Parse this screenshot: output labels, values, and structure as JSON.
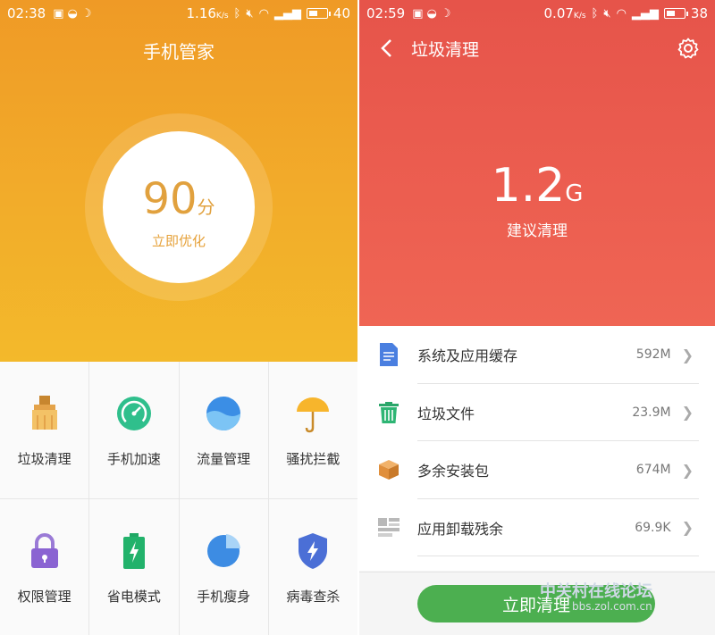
{
  "left": {
    "status": {
      "time": "02:38",
      "speed": "1.16",
      "speed_unit": "K/s",
      "battery": "40"
    },
    "title": "手机管家",
    "score": {
      "value": "90",
      "unit": "分",
      "action": "立即优化"
    },
    "tiles": [
      {
        "label": "垃圾清理",
        "icon": "broom-icon"
      },
      {
        "label": "手机加速",
        "icon": "speedometer-icon"
      },
      {
        "label": "流量管理",
        "icon": "water-globe-icon"
      },
      {
        "label": "骚扰拦截",
        "icon": "umbrella-icon"
      },
      {
        "label": "权限管理",
        "icon": "lock-icon"
      },
      {
        "label": "省电模式",
        "icon": "battery-bolt-icon"
      },
      {
        "label": "手机瘦身",
        "icon": "pie-chart-icon"
      },
      {
        "label": "病毒查杀",
        "icon": "shield-bolt-icon"
      }
    ]
  },
  "right": {
    "status": {
      "time": "02:59",
      "speed": "0.07",
      "speed_unit": "K/s",
      "battery": "38"
    },
    "title": "垃圾清理",
    "size": {
      "value": "1.2",
      "unit": "G",
      "caption": "建议清理"
    },
    "items": [
      {
        "label": "系统及应用缓存",
        "size": "592M",
        "icon": "document-icon"
      },
      {
        "label": "垃圾文件",
        "size": "23.9M",
        "icon": "trash-icon"
      },
      {
        "label": "多余安装包",
        "size": "674M",
        "icon": "package-box-icon"
      },
      {
        "label": "应用卸载残余",
        "size": "69.9K",
        "icon": "residue-grid-icon"
      }
    ],
    "clean_button": "立即清理"
  },
  "watermark": {
    "text": "中关村在线论坛",
    "url": "bbs.zol.com.cn"
  },
  "colors": {
    "orange": "#f2ac2a",
    "red": "#ec5e50",
    "green": "#4caf50"
  }
}
